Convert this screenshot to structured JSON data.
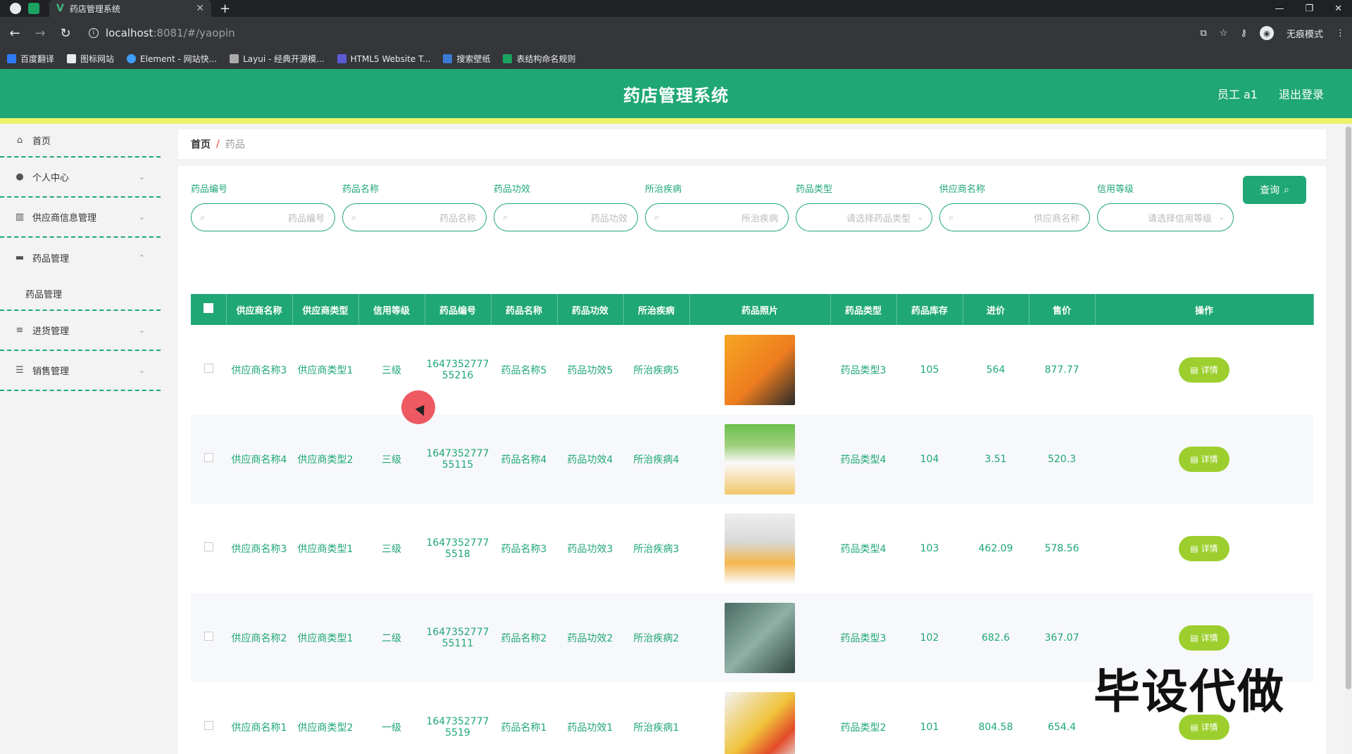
{
  "browser": {
    "tab_title": "药店管理系统",
    "url_host": "localhost",
    "url_path": ":8081/#/yaopin",
    "profile_label": "无痕模式",
    "bookmarks": [
      "百度翻译",
      "图标网站",
      "Element - 网站快...",
      "Layui - 经典开源模...",
      "HTML5 Website T...",
      "搜索壁纸",
      "表结构命名规则"
    ]
  },
  "header": {
    "title": "药店管理系统",
    "user_label": "员工 a1",
    "logout_label": "退出登录"
  },
  "sidebar": {
    "items": [
      {
        "label": "首页",
        "icon": "home-icon"
      },
      {
        "label": "个人中心",
        "icon": "user-icon"
      },
      {
        "label": "供应商信息管理",
        "icon": "chart-icon"
      },
      {
        "label": "药品管理",
        "icon": "monitor-icon"
      },
      {
        "label": "进货管理",
        "icon": "list-icon"
      },
      {
        "label": "销售管理",
        "icon": "sliders-icon"
      }
    ],
    "subitem": "药品管理"
  },
  "breadcrumb": {
    "home": "首页",
    "separator": "/",
    "current": "药品"
  },
  "filters": [
    {
      "label": "药品编号",
      "placeholder": "药品编号",
      "type": "input"
    },
    {
      "label": "药品名称",
      "placeholder": "药品名称",
      "type": "input"
    },
    {
      "label": "药品功效",
      "placeholder": "药品功效",
      "type": "input"
    },
    {
      "label": "所治疾病",
      "placeholder": "所治疾病",
      "type": "input"
    },
    {
      "label": "药品类型",
      "placeholder": "请选择药品类型",
      "type": "select"
    },
    {
      "label": "供应商名称",
      "placeholder": "供应商名称",
      "type": "input"
    },
    {
      "label": "信用等级",
      "placeholder": "请选择信用等级",
      "type": "select"
    }
  ],
  "search_button": "查询",
  "table": {
    "columns": [
      "供应商名称",
      "供应商类型",
      "信用等级",
      "药品编号",
      "药品名称",
      "药品功效",
      "所治疾病",
      "药品照片",
      "药品类型",
      "药品库存",
      "进价",
      "售价",
      "操作"
    ],
    "rows": [
      {
        "supplier": "供应商名称3",
        "stype": "供应商类型1",
        "credit": "三级",
        "code": "164735277755216",
        "name": "药品名称5",
        "effect": "药品功效5",
        "disease": "所治疾病5",
        "dtype": "药品类型3",
        "stock": "105",
        "cost": "564",
        "price": "877.77"
      },
      {
        "supplier": "供应商名称4",
        "stype": "供应商类型2",
        "credit": "三级",
        "code": "164735277755115",
        "name": "药品名称4",
        "effect": "药品功效4",
        "disease": "所治疾病4",
        "dtype": "药品类型4",
        "stock": "104",
        "cost": "3.51",
        "price": "520.3"
      },
      {
        "supplier": "供应商名称3",
        "stype": "供应商类型1",
        "credit": "三级",
        "code": "16473527775518",
        "name": "药品名称3",
        "effect": "药品功效3",
        "disease": "所治疾病3",
        "dtype": "药品类型4",
        "stock": "103",
        "cost": "462.09",
        "price": "578.56"
      },
      {
        "supplier": "供应商名称2",
        "stype": "供应商类型1",
        "credit": "二级",
        "code": "164735277755111",
        "name": "药品名称2",
        "effect": "药品功效2",
        "disease": "所治疾病2",
        "dtype": "药品类型3",
        "stock": "102",
        "cost": "682.6",
        "price": "367.07"
      },
      {
        "supplier": "供应商名称1",
        "stype": "供应商类型2",
        "credit": "一级",
        "code": "16473527775519",
        "name": "药品名称1",
        "effect": "药品功效1",
        "disease": "所治疾病1",
        "dtype": "药品类型2",
        "stock": "101",
        "cost": "804.58",
        "price": "654.4"
      }
    ],
    "detail_label": "详情"
  },
  "watermark": "毕设代做",
  "colors": {
    "primary": "#1fa775",
    "accent_strip": "#eef26a",
    "detail_button": "#9ccf2e"
  }
}
